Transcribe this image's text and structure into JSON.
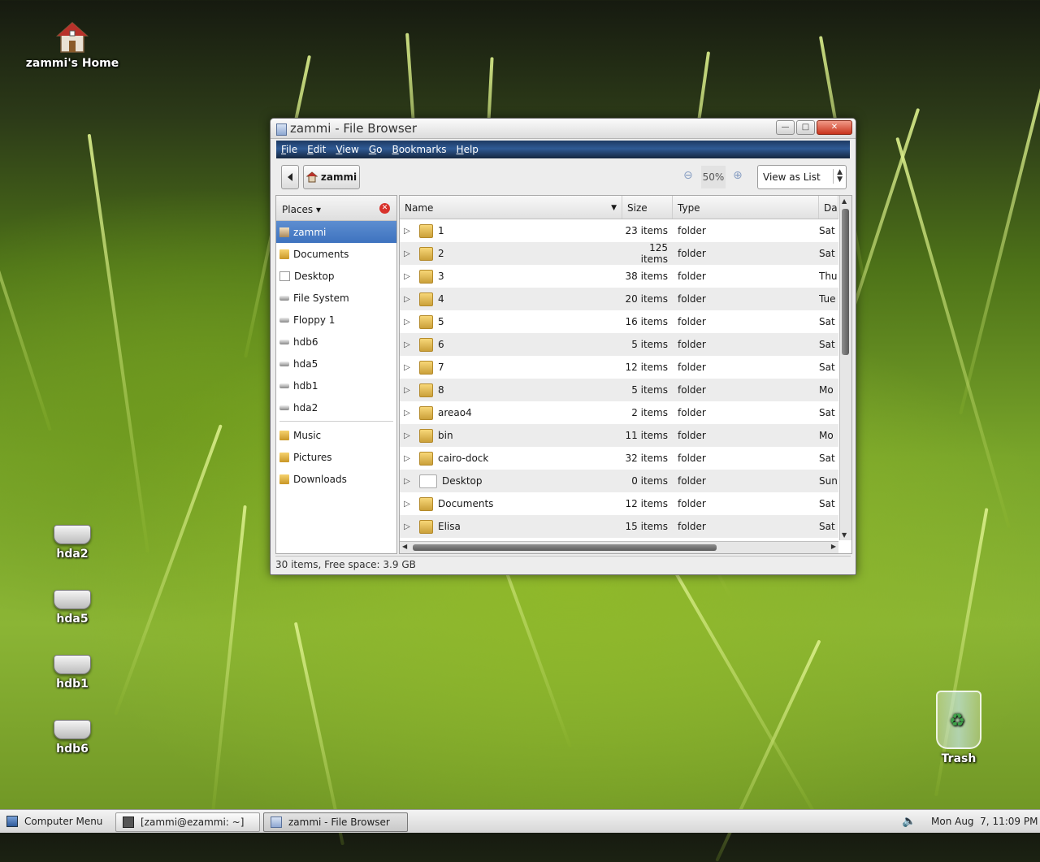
{
  "desktop": {
    "home_label": "zammi's Home",
    "drives": [
      "hda2",
      "hda5",
      "hdb1",
      "hdb6"
    ],
    "trash_label": "Trash"
  },
  "window": {
    "title": "zammi - File Browser",
    "buttons": {
      "minimize": "—",
      "maximize": "□",
      "close": "✕"
    },
    "menu": [
      {
        "label": "File",
        "key": "F",
        "rest": "ile"
      },
      {
        "label": "Edit",
        "key": "E",
        "rest": "dit"
      },
      {
        "label": "View",
        "key": "V",
        "rest": "iew"
      },
      {
        "label": "Go",
        "key": "G",
        "rest": "o"
      },
      {
        "label": "Bookmarks",
        "key": "B",
        "rest": "ookmarks"
      },
      {
        "label": "Help",
        "key": "H",
        "rest": "elp"
      }
    ],
    "toolbar": {
      "location_label": "zammi",
      "zoom_level": "50%",
      "view_mode": "View as List"
    },
    "sidebar": {
      "header": "Places",
      "items": [
        {
          "label": "zammi",
          "icon": "home-icon",
          "selected": true
        },
        {
          "label": "Documents",
          "icon": "folder-icon"
        },
        {
          "label": "Desktop",
          "icon": "desktop-icon"
        },
        {
          "label": "File System",
          "icon": "drive-icon"
        },
        {
          "label": "Floppy 1",
          "icon": "floppy-icon"
        },
        {
          "label": "hdb6",
          "icon": "drive-icon"
        },
        {
          "label": "hda5",
          "icon": "drive-icon"
        },
        {
          "label": "hdb1",
          "icon": "drive-icon"
        },
        {
          "label": "hda2",
          "icon": "drive-icon"
        }
      ],
      "bookmarks": [
        {
          "label": "Music",
          "icon": "folder-icon"
        },
        {
          "label": "Pictures",
          "icon": "folder-icon"
        },
        {
          "label": "Downloads",
          "icon": "folder-icon"
        }
      ]
    },
    "columns": {
      "name": "Name",
      "size": "Size",
      "type": "Type",
      "date": "Da"
    },
    "files": [
      {
        "name": "1",
        "size": "23 items",
        "type": "folder",
        "date": "Sat"
      },
      {
        "name": "2",
        "size": "125 items",
        "type": "folder",
        "date": "Sat"
      },
      {
        "name": "3",
        "size": "38 items",
        "type": "folder",
        "date": "Thu"
      },
      {
        "name": "4",
        "size": "20 items",
        "type": "folder",
        "date": "Tue"
      },
      {
        "name": "5",
        "size": "16 items",
        "type": "folder",
        "date": "Sat"
      },
      {
        "name": "6",
        "size": "5 items",
        "type": "folder",
        "date": "Sat"
      },
      {
        "name": "7",
        "size": "12 items",
        "type": "folder",
        "date": "Sat"
      },
      {
        "name": "8",
        "size": "5 items",
        "type": "folder",
        "date": "Mo"
      },
      {
        "name": "areao4",
        "size": "2 items",
        "type": "folder",
        "date": "Sat"
      },
      {
        "name": "bin",
        "size": "11 items",
        "type": "folder",
        "date": "Mo"
      },
      {
        "name": "cairo-dock",
        "size": "32 items",
        "type": "folder",
        "date": "Sat"
      },
      {
        "name": "Desktop",
        "size": "0 items",
        "type": "folder",
        "date": "Sun",
        "white": true
      },
      {
        "name": "Documents",
        "size": "12 items",
        "type": "folder",
        "date": "Sat"
      },
      {
        "name": "Elisa",
        "size": "15 items",
        "type": "folder",
        "date": "Sat"
      }
    ],
    "status": "30 items, Free space: 3.9 GB"
  },
  "taskbar": {
    "menu_label": "Computer Menu",
    "terminal_label": "[zammi@ezammi: ~]",
    "browser_label": "zammi - File Browser",
    "clock": "Mon Aug  7, 11:09 PM"
  }
}
